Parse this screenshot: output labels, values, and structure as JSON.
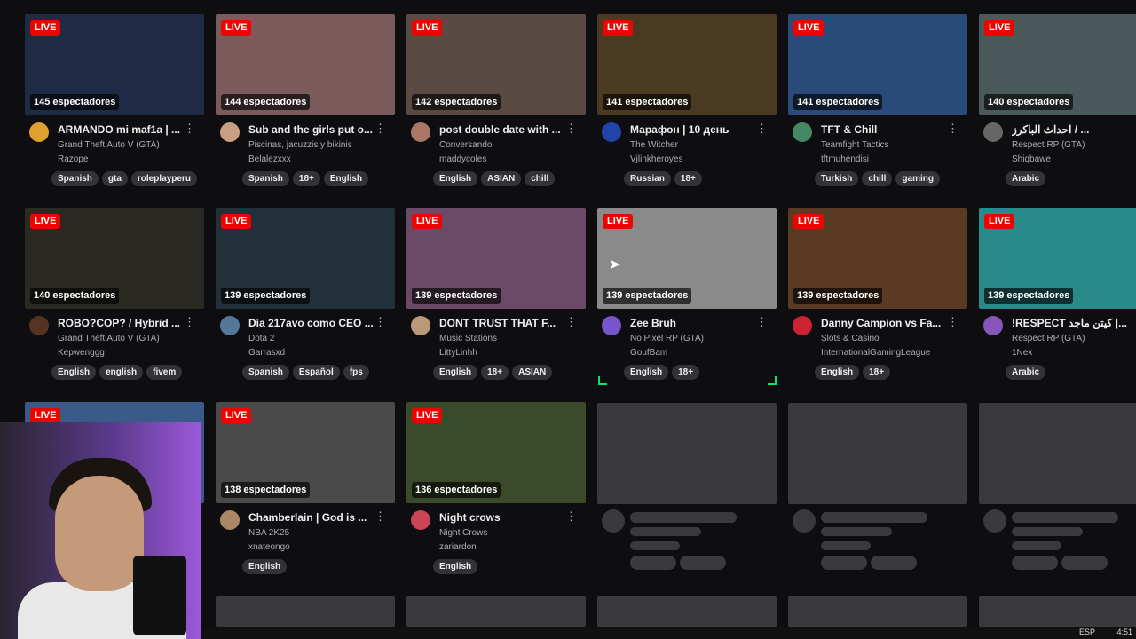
{
  "live_label": "LIVE",
  "rows": [
    [
      {
        "viewers": "145 espectadores",
        "title": "ARMANDO mi maf1a | ...",
        "game": "Grand Theft Auto V (GTA)",
        "user": "Razope",
        "tags": [
          "Spanish",
          "gta",
          "roleplayperu"
        ],
        "thumb_color": "#1f2a44",
        "avatar_color": "#e0a030"
      },
      {
        "viewers": "144 espectadores",
        "title": "Sub and the girls put o...",
        "game": "Piscinas, jacuzzis y bikinis",
        "user": "Belalezxxx",
        "tags": [
          "Spanish",
          "18+",
          "English"
        ],
        "thumb_color": "#7a5a5a",
        "avatar_color": "#c8a080"
      },
      {
        "viewers": "142 espectadores",
        "title": "post double date with ...",
        "game": "Conversando",
        "user": "maddycoles",
        "tags": [
          "English",
          "ASIAN",
          "chill"
        ],
        "thumb_color": "#5a4a44",
        "avatar_color": "#aa7766"
      },
      {
        "viewers": "141 espectadores",
        "title": "Марафон | 10 день",
        "game": "The Witcher",
        "user": "Vjlinkheroyes",
        "tags": [
          "Russian",
          "18+"
        ],
        "thumb_color": "#4a3a22",
        "avatar_color": "#2244aa"
      },
      {
        "viewers": "141 espectadores",
        "title": "TFT & Chill",
        "game": "Teamfight Tactics",
        "user": "tftmuhendisi",
        "tags": [
          "Turkish",
          "chill",
          "gaming"
        ],
        "thumb_color": "#2a4a7a",
        "avatar_color": "#448866"
      },
      {
        "viewers": "140 espectadores",
        "title": "احداث الباكرز / ...",
        "game": "Respect RP (GTA)",
        "user": "Shiqbawe",
        "tags": [
          "Arabic"
        ],
        "thumb_color": "#4a5a5a",
        "avatar_color": "#666666"
      }
    ],
    [
      {
        "viewers": "140 espectadores",
        "title": "ROBO?COP? / Hybrid ...",
        "game": "Grand Theft Auto V (GTA)",
        "user": "Kepwenggg",
        "tags": [
          "English",
          "english",
          "fivem"
        ],
        "thumb_color": "#2a2a22",
        "avatar_color": "#553322"
      },
      {
        "viewers": "139 espectadores",
        "title": "Día 217avo como CEO ...",
        "game": "Dota 2",
        "user": "Garrasxd",
        "tags": [
          "Spanish",
          "Español",
          "fps"
        ],
        "thumb_color": "#22303a",
        "avatar_color": "#557799"
      },
      {
        "viewers": "139 espectadores",
        "title": "DONT TRUST THAT F...",
        "game": "Music Stations",
        "user": "LittyLinhh",
        "tags": [
          "English",
          "18+",
          "ASIAN"
        ],
        "thumb_color": "#6a4a66",
        "avatar_color": "#bb9977"
      },
      {
        "viewers": "139 espectadores",
        "title": "Zee Bruh",
        "game": "No Pixel RP (GTA)",
        "user": "GoufBam",
        "tags": [
          "English",
          "18+"
        ],
        "thumb_color": "#8a8a8a",
        "avatar_color": "#7755cc"
      },
      {
        "viewers": "139 espectadores",
        "title": "Danny Campion vs Fa...",
        "game": "Slots & Casino",
        "user": "InternationalGamingLeague",
        "tags": [
          "English",
          "18+"
        ],
        "thumb_color": "#5a3a22",
        "avatar_color": "#cc2233"
      },
      {
        "viewers": "139 espectadores",
        "title": "!RESPECT كيتن ماجد |...",
        "game": "Respect RP (GTA)",
        "user": "1Nex",
        "tags": [
          "Arabic"
        ],
        "thumb_color": "#2a8a8a",
        "avatar_color": "#8855bb"
      }
    ],
    [
      {
        "viewers": "",
        "title": "",
        "game": "",
        "user": "",
        "tags": [],
        "thumb_color": "#3a5a8a",
        "avatar_color": "#333333"
      },
      {
        "viewers": "138 espectadores",
        "title": "Chamberlain | God is ...",
        "game": "NBA 2K25",
        "user": "xnateongo",
        "tags": [
          "English"
        ],
        "thumb_color": "#4a4a4a",
        "avatar_color": "#aa8866"
      },
      {
        "viewers": "136 espectadores",
        "title": "Night crows",
        "game": "Night Crows",
        "user": "zariardon",
        "tags": [
          "English"
        ],
        "thumb_color": "#3a4a2a",
        "avatar_color": "#cc4455"
      }
    ]
  ],
  "taskbar": {
    "lang": "ESP",
    "time": "4:51"
  }
}
